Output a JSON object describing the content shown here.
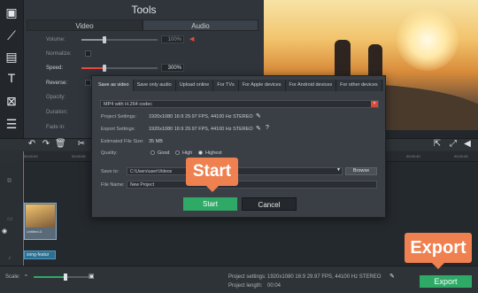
{
  "tools_panel": {
    "title": "Tools",
    "tabs": [
      "Video",
      "Audio"
    ],
    "properties": [
      {
        "label": "Volume:",
        "value": "100%",
        "level": 0.3,
        "enabled": false
      },
      {
        "label": "Normalize:",
        "enabled": false
      },
      {
        "label": "Speed:",
        "value": "300%",
        "level": 0.3,
        "enabled": true
      },
      {
        "label": "Reverse:",
        "enabled": true
      },
      {
        "label": "Opacity:",
        "enabled": false
      },
      {
        "label": "Duration:",
        "enabled": false
      },
      {
        "label": "Fade in:",
        "enabled": false
      }
    ]
  },
  "timeline": {
    "ruler_ticks": [
      "00:00:00",
      "00:00:05",
      "00:00:10",
      "00:00:15",
      "00:00:20",
      "00:00:25",
      "00:00:30",
      "00:00:35",
      "00:00:40",
      "00:00:45"
    ],
    "video_clip_name": "Untitled-3",
    "audio_clip_name": "song-featur"
  },
  "dialog": {
    "tabs": [
      "Save as video",
      "Save only audio",
      "Upload online",
      "For TVs",
      "For Apple devices",
      "For Android devices",
      "For other devices"
    ],
    "active_tab": "Save as video",
    "format": "MP4 with H.264 codec",
    "project_settings_label": "Project Settings:",
    "project_settings_value": "1920x1080 16:9 29.97 FPS, 44100 Hz STEREO",
    "export_settings_label": "Export Settings:",
    "export_settings_value": "1920x1080 16:9 29.97 FPS, 44100 Hz STEREO",
    "file_size_label": "Estimated File Size:",
    "file_size_value": "35 MB",
    "quality_label": "Quality:",
    "quality_options": [
      "Good",
      "High",
      "Highest"
    ],
    "quality_selected": "Highest",
    "save_to_label": "Save to:",
    "save_to_value": "C:\\Users\\user\\Videos",
    "browse_label": "Browse",
    "file_name_label": "File Name:",
    "file_name_value": "New Project",
    "start_label": "Start",
    "cancel_label": "Cancel"
  },
  "callouts": {
    "start": "Start",
    "export": "Export"
  },
  "bottom_bar": {
    "scale_label": "Scale:",
    "project_settings_label": "Project settings:",
    "project_settings_value": "1920x1080 16:9 29.97 FPS, 44100 Hz STEREO",
    "project_length_label": "Project length:",
    "project_length_value": "00:04",
    "export_label": "Export"
  },
  "colors": {
    "accent_green": "#2eaa66",
    "callout_orange": "#ef8050",
    "playhead_red": "#e84a3c"
  }
}
